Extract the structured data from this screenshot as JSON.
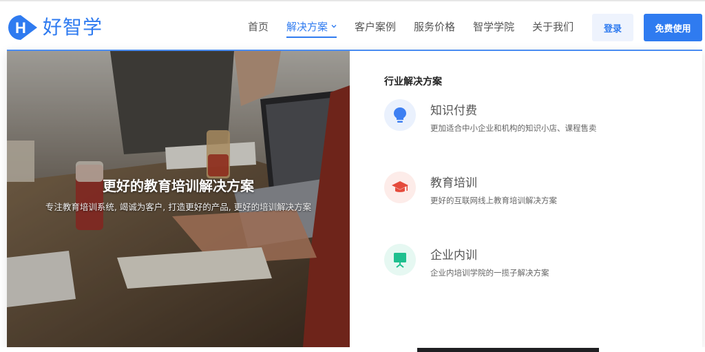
{
  "brand": {
    "logo_letter": "H",
    "name": "好智学"
  },
  "nav": {
    "items": [
      {
        "label": "首页"
      },
      {
        "label": "解决方案"
      },
      {
        "label": "客户案例"
      },
      {
        "label": "服务价格"
      },
      {
        "label": "智学学院"
      },
      {
        "label": "关于我们"
      }
    ],
    "active_index": 1
  },
  "actions": {
    "login_label": "登录",
    "trial_label": "免费使用"
  },
  "banner": {
    "title": "更好的教育培训解决方案",
    "subtitle": "专注教育培训系统, 竭诚为客户, 打造更好的产品, 更好的培训解决方案"
  },
  "solutions": {
    "heading": "行业解决方案",
    "items": [
      {
        "title": "知识付费",
        "desc": "更加适合中小企业和机构的知识小店、课程售卖",
        "icon": "lightbulb-icon",
        "color": "#3d7ff2",
        "bg": "#eaf1fd"
      },
      {
        "title": "教育培训",
        "desc": "更好的互联网线上教育培训解决方案",
        "icon": "graduation-cap-icon",
        "color": "#e54b3c",
        "bg": "#fdece9"
      },
      {
        "title": "企业内训",
        "desc": "企业内培训学院的一揽子解决方案",
        "icon": "presentation-board-icon",
        "color": "#1fbf8f",
        "bg": "#e6f8f2"
      }
    ]
  },
  "colors": {
    "accent": "#2f7bf0",
    "panel_border": "#4a8cf2"
  }
}
